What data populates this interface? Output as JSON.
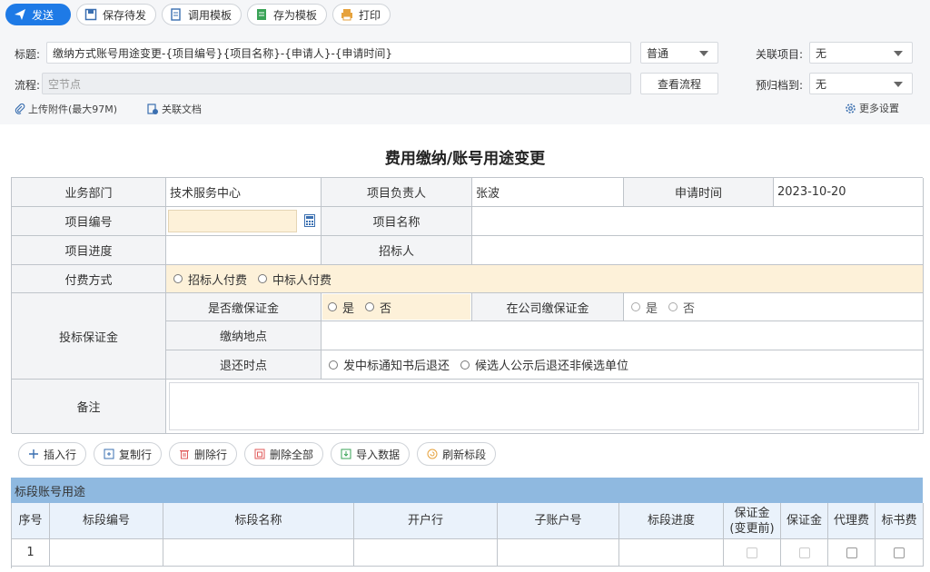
{
  "toolbar": {
    "send": "发送",
    "save_draft": "保存待发",
    "use_template": "调用模板",
    "save_template": "存为模板",
    "print": "打印"
  },
  "header": {
    "title_label": "标题:",
    "title_value": "缴纳方式账号用途变更-{项目编号}{项目名称}-{申请人}-{申请时间}",
    "priority": "普通",
    "related_project_label": "关联项目:",
    "related_project_value": "无",
    "flow_label": "流程:",
    "flow_placeholder": "空节点",
    "view_flow": "查看流程",
    "archive_label": "预归档到:",
    "archive_value": "无",
    "upload": "上传附件(最大97M)",
    "related_doc": "关联文档",
    "more_settings": "更多设置"
  },
  "form": {
    "title": "费用缴纳/账号用途变更",
    "dept_label": "业务部门",
    "dept_value": "技术服务中心",
    "owner_label": "项目负责人",
    "owner_value": "张波",
    "apply_time_label": "申请时间",
    "apply_time_value": "2023-10-20",
    "proj_no_label": "项目编号",
    "proj_name_label": "项目名称",
    "proj_progress_label": "项目进度",
    "tenderer_label": "招标人",
    "pay_method_label": "付费方式",
    "pay_opt1": "招标人付费",
    "pay_opt2": "中标人付费",
    "bond_label": "投标保证金",
    "bond_paid_label": "是否缴保证金",
    "yes": "是",
    "no": "否",
    "company_bond_label": "在公司缴保证金",
    "pay_place_label": "缴纳地点",
    "refund_label": "退还时点",
    "refund_opt1": "发中标通知书后退还",
    "refund_opt2": "候选人公示后退还非候选单位",
    "remark_label": "备注"
  },
  "actions": {
    "insert": "插入行",
    "copy": "复制行",
    "delete": "删除行",
    "delete_all": "删除全部",
    "import": "导入数据",
    "refresh": "刷新标段"
  },
  "section": {
    "title": "标段账号用途",
    "columns": [
      "序号",
      "标段编号",
      "标段名称",
      "开户行",
      "子账户号",
      "标段进度",
      "保证金\n(变更前)",
      "保证金",
      "代理费",
      "标书费"
    ],
    "rows": [
      [
        "1"
      ]
    ]
  }
}
